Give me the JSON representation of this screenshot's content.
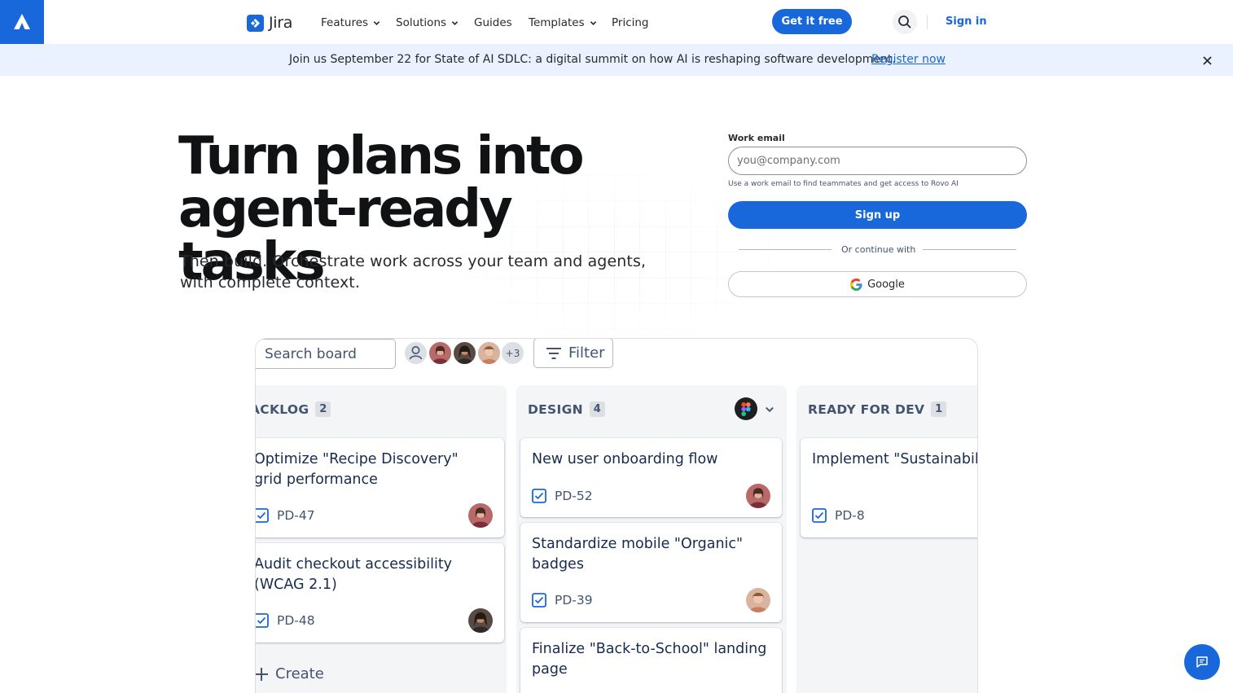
{
  "nav": {
    "brand": "Jira",
    "items": [
      {
        "label": "Features",
        "has_menu": true
      },
      {
        "label": "Solutions",
        "has_menu": true
      },
      {
        "label": "Guides",
        "has_menu": false
      },
      {
        "label": "Templates",
        "has_menu": true
      },
      {
        "label": "Pricing",
        "has_menu": false
      }
    ],
    "cta": "Get it free",
    "signin": "Sign in",
    "accent": "#1868db"
  },
  "banner": {
    "text": "Join us September 22 for State of AI SDLC: a digital summit on how AI is reshaping software development.",
    "link": "Register now"
  },
  "hero": {
    "title_line1": "Turn plans into",
    "title_line2": "agent-ready tasks",
    "subtitle": "Then build. Orchestrate work across your team and agents, with complete context."
  },
  "form": {
    "label": "Work email",
    "placeholder": "you@company.com",
    "hint": "Use a work email to find teammates and get access to Rovo AI",
    "signup": "Sign up",
    "divider": "Or continue with",
    "google": "Google"
  },
  "board": {
    "search_placeholder": "Search board",
    "more_avatars": "+3",
    "filter": "Filter",
    "columns": [
      {
        "name": "ACKLOG",
        "count": "2",
        "cards": [
          {
            "title": "Optimize \"Recipe Discovery\" grid performance",
            "key": "PD-47"
          },
          {
            "title": "Audit checkout accessibility (WCAG 2.1)",
            "key": "PD-48"
          }
        ],
        "create": "Create"
      },
      {
        "name": "DESIGN",
        "count": "4",
        "cards": [
          {
            "title": "New user onboarding flow",
            "key": "PD-52"
          },
          {
            "title": "Standardize mobile \"Organic\" badges",
            "key": "PD-39"
          },
          {
            "title": "Finalize \"Back-to-School\" landing page",
            "key": ""
          }
        ]
      },
      {
        "name": "READY FOR DEV",
        "count": "1",
        "cards": [
          {
            "title": "Implement \"Sustainability\" video streaming",
            "key": "PD-8"
          }
        ]
      }
    ]
  }
}
